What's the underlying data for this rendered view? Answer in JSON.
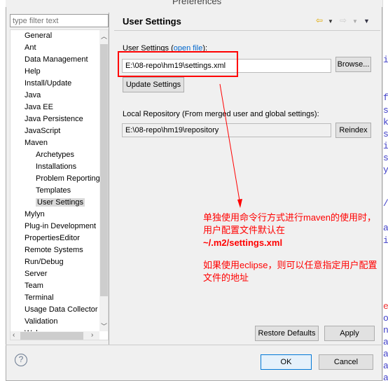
{
  "window": {
    "title": "Preferences"
  },
  "filter": {
    "placeholder": "type filter text"
  },
  "tree": {
    "items": [
      {
        "label": "General",
        "indent": 0
      },
      {
        "label": "Ant",
        "indent": 0
      },
      {
        "label": "Data Management",
        "indent": 0
      },
      {
        "label": "Help",
        "indent": 0
      },
      {
        "label": "Install/Update",
        "indent": 0
      },
      {
        "label": "Java",
        "indent": 0
      },
      {
        "label": "Java EE",
        "indent": 0
      },
      {
        "label": "Java Persistence",
        "indent": 0
      },
      {
        "label": "JavaScript",
        "indent": 0
      },
      {
        "label": "Maven",
        "indent": 0
      },
      {
        "label": "Archetypes",
        "indent": 1
      },
      {
        "label": "Installations",
        "indent": 1
      },
      {
        "label": "Problem Reporting",
        "indent": 1
      },
      {
        "label": "Templates",
        "indent": 1
      },
      {
        "label": "User Settings",
        "indent": 1,
        "selected": true
      },
      {
        "label": "Mylyn",
        "indent": 0
      },
      {
        "label": "Plug-in Development",
        "indent": 0
      },
      {
        "label": "PropertiesEditor",
        "indent": 0
      },
      {
        "label": "Remote Systems",
        "indent": 0
      },
      {
        "label": "Run/Debug",
        "indent": 0
      },
      {
        "label": "Server",
        "indent": 0
      },
      {
        "label": "Team",
        "indent": 0
      },
      {
        "label": "Terminal",
        "indent": 0
      },
      {
        "label": "Usage Data Collector",
        "indent": 0
      },
      {
        "label": "Validation",
        "indent": 0
      },
      {
        "label": "Web",
        "indent": 0
      }
    ]
  },
  "page": {
    "title": "User Settings",
    "user_settings_label": "User Settings (",
    "open_file_link": "open file",
    "user_settings_label_end": "):",
    "user_settings_value": "E:\\08-repo\\hm19\\settings.xml",
    "browse_label": "Browse...",
    "update_label": "Update Settings",
    "local_repo_label": "Local Repository (From merged user and global settings):",
    "local_repo_value": "E:\\08-repo\\hm19\\repository",
    "reindex_label": "Reindex",
    "restore_label": "Restore Defaults",
    "apply_label": "Apply"
  },
  "footer": {
    "ok_label": "OK",
    "cancel_label": "Cancel"
  },
  "annotation": {
    "line1": "单独使用命令行方式进行maven的使用时，用户配置文件默认在",
    "line2": "~/.m2/settings.xml",
    "line3": "如果使用eclipse，则可以任意指定用户配置文件的地址",
    "color": "#ff0000"
  },
  "background_code": [
    "i",
    "f",
    "s",
    "k",
    "s",
    "i",
    "s",
    "y",
    "/",
    "a",
    "i",
    "e",
    "o",
    "n",
    "a",
    "a",
    "a",
    "a"
  ]
}
